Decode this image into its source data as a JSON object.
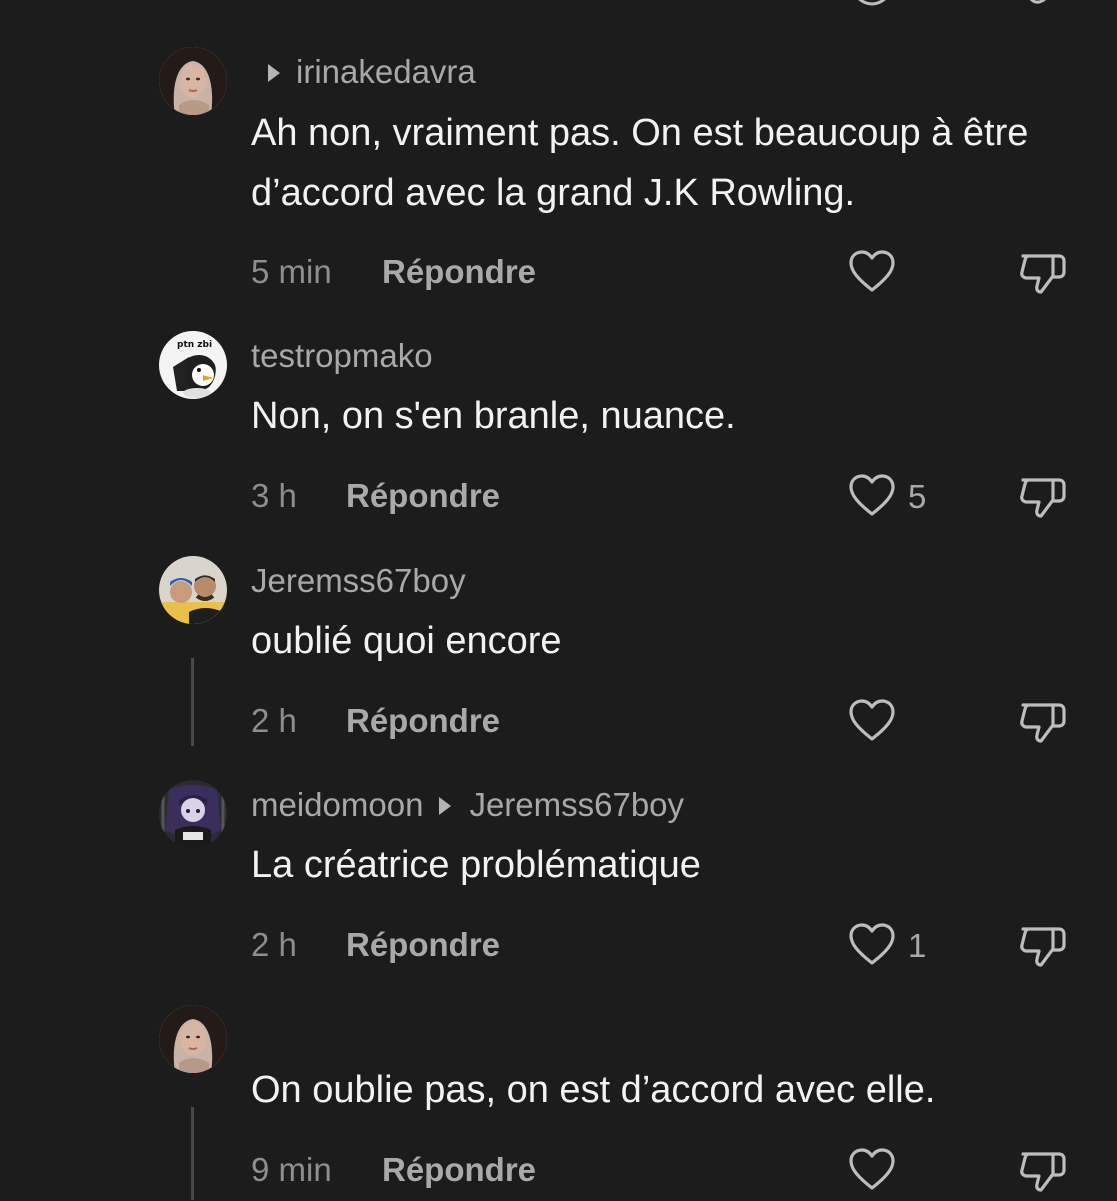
{
  "reply_label": "Répondre",
  "colors": {
    "background": "#1c1c1c",
    "username": "#a8a8a8",
    "text": "#f2f2f2",
    "meta": "#8e8e8e",
    "icon": "#bdbdbd"
  },
  "comments": [
    {
      "username": "irinakedavra",
      "reply_to_arrow": true,
      "text": "Ah non, vraiment pas. On est beaucoup à être d’accord avec la grand J.K Rowling.",
      "time": "5 min",
      "likes": "",
      "icons": [
        "avatar",
        "heart-icon",
        "thumbs-down-icon"
      ]
    },
    {
      "username": "testropmako",
      "avatar_text": "ptn zbi",
      "text": "Non, on s'en branle, nuance.",
      "time": "3 h",
      "likes": "5"
    },
    {
      "username": "Jeremss67boy",
      "text": "oublié quoi encore",
      "time": "2 h",
      "likes": ""
    },
    {
      "username": "meidomoon",
      "reply_to": "Jeremss67boy",
      "text": "La créatrice problématique",
      "time": "2 h",
      "likes": "1"
    },
    {
      "username": "",
      "text": "On oublie pas, on est d’accord avec elle.",
      "time": "9 min",
      "likes": ""
    }
  ]
}
